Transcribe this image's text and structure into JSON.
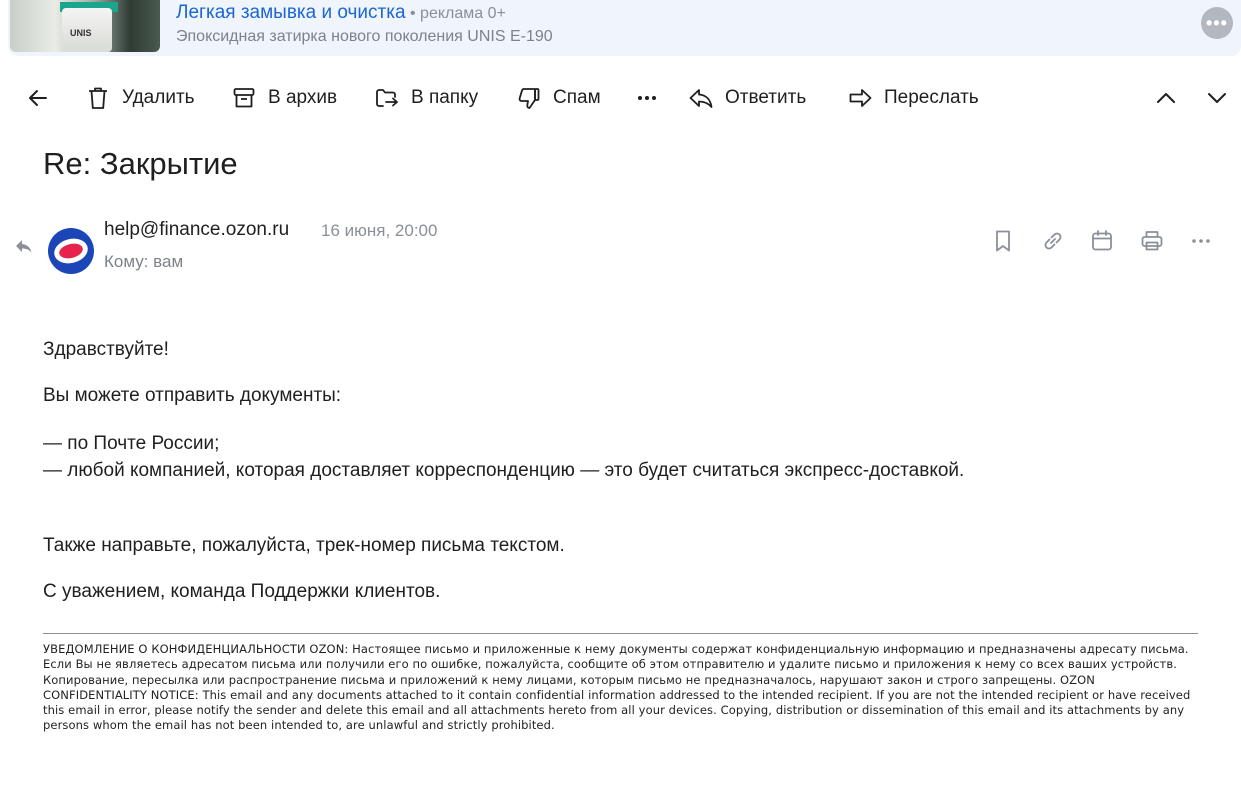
{
  "ad": {
    "title": "Легкая замывка и очистка",
    "tag": " • реклама 0+",
    "subtitle": "Эпоксидная затирка нового поколения UNIS E-190",
    "image_brand": "UNIS",
    "more_label": "•••"
  },
  "toolbar": {
    "delete_label": "Удалить",
    "archive_label": "В архив",
    "folder_label": "В папку",
    "spam_label": "Спам",
    "reply_label": "Ответить",
    "forward_label": "Переслать"
  },
  "message": {
    "subject": "Re: Закрытие",
    "sender": "help@finance.ozon.ru",
    "date": "16 июня, 20:00",
    "recipient": "Кому: вам",
    "greeting": "Здравствуйте!",
    "paragraph1": "Вы можете отправить документы:",
    "bullet1": "— по Почте России;",
    "bullet2": "— любой компанией, которая доставляет корреспонденцию — это будет считаться экспресс-доставкой.",
    "paragraph2": "Также направьте, пожалуйста, трек-номер письма текстом.",
    "signature": "С уважением, команда Поддержки клиентов.",
    "notice": "УВЕДОМЛЕНИЕ О КОНФИДЕНЦИАЛЬНОСТИ OZON: Настоящее письмо и приложенные к нему документы содержат конфиденциальную информацию и предназначены адресату письма. Если Вы не являетесь адресатом письма или получили его по ошибке, пожалуйста, сообщите об этом отправителю и удалите письмо и приложения к нему со всех ваших устройств. Копирование, пересылка или распространение письма и приложений к нему лицами, которым письмо не предназначалось, нарушают закон и строго запрещены. OZON CONFIDENTIALITY NOTICE: This email and any documents attached to it contain confidential information addressed to the intended recipient. If you are not the intended recipient or have received this email in error, please notify the sender and delete this email and all attachments hereto from all your devices. Copying, distribution or dissemination of this email and its attachments by any persons whom the email has not been intended to, are unlawful and strictly prohibited."
  },
  "colors": {
    "link_blue": "#1a66d6",
    "muted_gray": "#8a8f99",
    "ozon_blue": "#1c46b8",
    "ozon_red": "#e8234b",
    "ad_background": "#f0f4fb"
  },
  "icons": {
    "back": "arrow-left-icon",
    "delete": "trash-icon",
    "archive": "archive-box-icon",
    "folder": "move-to-folder-icon",
    "spam": "thumbs-down-icon",
    "more": "more-dots-icon",
    "reply": "reply-arrow-icon",
    "forward": "forward-arrow-icon",
    "prev": "chevron-up-icon",
    "next": "chevron-down-icon",
    "bookmark": "bookmark-icon",
    "link": "link-icon",
    "calendar": "calendar-icon",
    "print": "printer-icon",
    "message_more": "more-dots-icon"
  }
}
